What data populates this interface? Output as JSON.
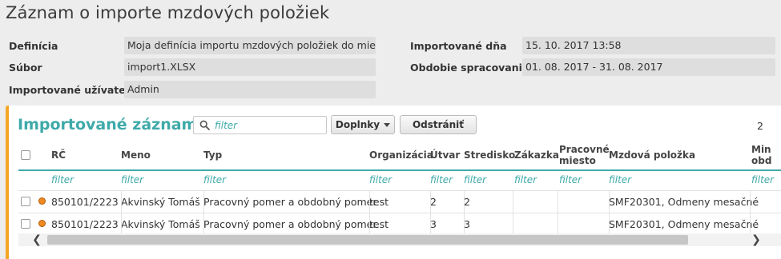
{
  "page": {
    "title": "Záznam o importe mzdových položiek"
  },
  "fields": {
    "definicia": {
      "label": "Definícia",
      "value": "Moja definícia importu mzdových položiek do miezd"
    },
    "subor": {
      "label": "Súbor",
      "value": "import1.XLSX"
    },
    "uzivatel": {
      "label": "Importované užívateľom",
      "value": "Admin"
    },
    "importovane_dna": {
      "label": "Importované dňa",
      "value": "15. 10. 2017  13:58"
    },
    "obdobie": {
      "label": "Obdobie spracovania",
      "value": "01. 08. 2017 - 31. 08. 2017"
    }
  },
  "panel": {
    "title": "Importované záznamy",
    "search_placeholder": "filter",
    "doplnky_label": "Doplnky",
    "odstranit_label": "Odstrániť",
    "count": "2",
    "accent_color": "#f5a623",
    "title_color": "#3fa9a9"
  },
  "table": {
    "columns": [
      "RČ",
      "Meno",
      "Typ",
      "Organizácia",
      "Útvar",
      "Stredisko",
      "Zákazka",
      "Pracovné miesto",
      "Mzdová položka",
      "Min obd"
    ],
    "filter_label": "filter",
    "rows": [
      {
        "rc": "850101/2223",
        "meno": "Akvinský Tomáš",
        "typ": "Pracovný pomer a obdobný pomer",
        "organizacia": "test",
        "utvar": "2",
        "stredisko": "2",
        "zakazka": "",
        "pracovne_miesto": "",
        "mzdova_polozka": "SMF20301, Odmeny mesačné",
        "status_color": "#f08a24"
      },
      {
        "rc": "850101/2223",
        "meno": "Akvinský Tomáš",
        "typ": "Pracovný pomer a obdobný pomer",
        "organizacia": "test",
        "utvar": "3",
        "stredisko": "3",
        "zakazka": "",
        "pracovne_miesto": "",
        "mzdova_polozka": "SMF20301, Odmeny mesačné",
        "status_color": "#f08a24"
      }
    ]
  },
  "scrollbar": {
    "left_arrow": "❮",
    "right_arrow": "❯"
  }
}
